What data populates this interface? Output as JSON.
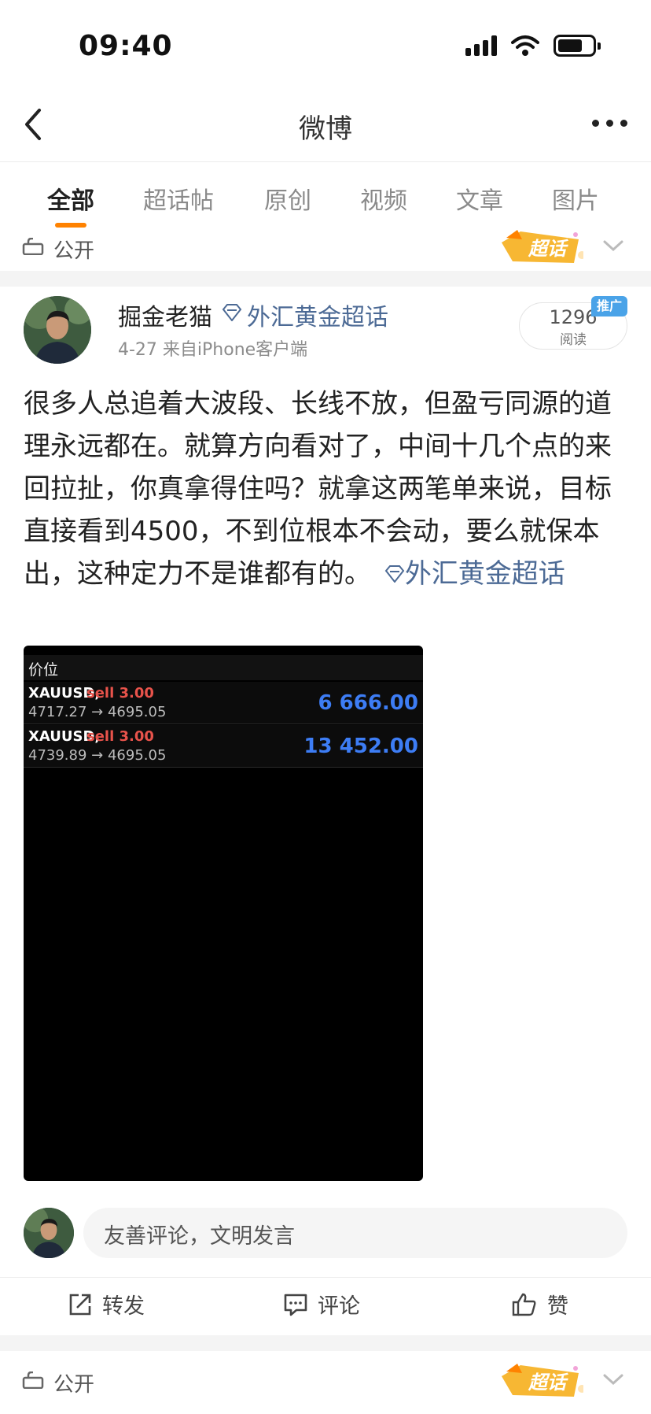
{
  "status_bar": {
    "time": "09:40"
  },
  "nav": {
    "title": "微博"
  },
  "tabs": [
    {
      "label": "全部",
      "active": true
    },
    {
      "label": "超话帖",
      "active": false
    },
    {
      "label": "原创",
      "active": false
    },
    {
      "label": "视频",
      "active": false
    },
    {
      "label": "文章",
      "active": false
    },
    {
      "label": "图片",
      "active": false
    }
  ],
  "visibility": {
    "label": "公开",
    "badge": "超话"
  },
  "post": {
    "username": "掘金老猫",
    "topic": "外汇黄金超话",
    "meta": "4-27  来自iPhone客户端",
    "read_count": "1296",
    "read_label": "阅读",
    "ad_tag": "推广",
    "text": "很多人总追着大波段、长线不放，但盈亏同源的道理永远都在。就算方向看对了，中间十几个点的来回拉扯，你真拿得住吗？就拿这两笔单来说，目标直接看到4500，不到位根本不会动，要么就保本出，这种定力不是谁都有的。",
    "text_topic": "外汇黄金超话",
    "image": {
      "price_label": "价位",
      "orders": [
        {
          "symbol": "XAUUSD,",
          "side": "sell 3.00",
          "prices": "4717.27 → 4695.05",
          "profit": "6 666.00"
        },
        {
          "symbol": "XAUUSD,",
          "side": "sell 3.00",
          "prices": "4739.89 → 4695.05",
          "profit": "13 452.00"
        }
      ]
    }
  },
  "comment": {
    "placeholder": "友善评论，文明发言"
  },
  "actions": {
    "repost": "转发",
    "comment": "评论",
    "like": "赞"
  },
  "next_post": {
    "visibility_label": "公开",
    "badge": "超话"
  },
  "colors": {
    "accent": "#ff8200",
    "link": "#4c6a95",
    "profit": "#3d7df5",
    "sell": "#e8534b"
  }
}
